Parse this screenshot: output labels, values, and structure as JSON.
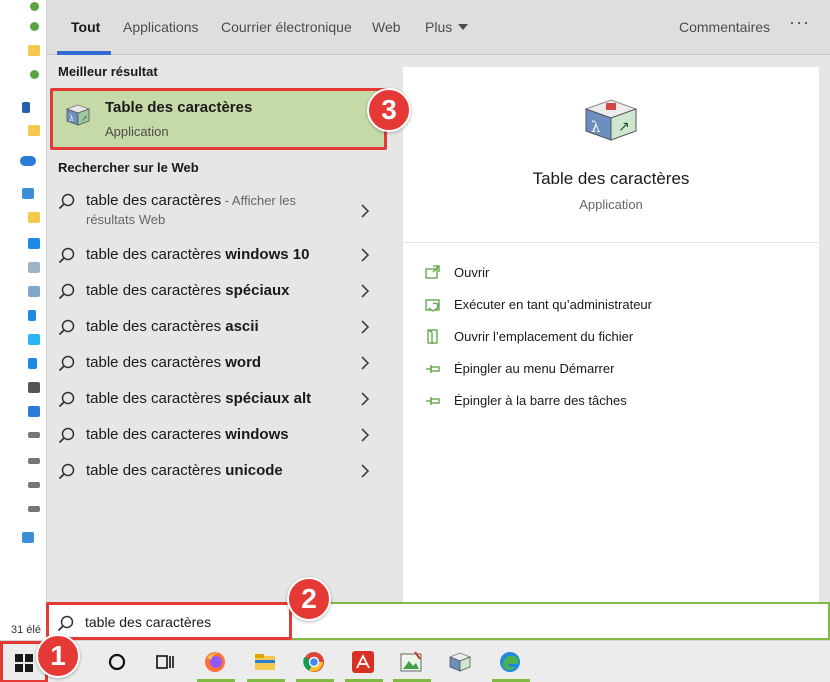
{
  "tabs": {
    "all": "Tout",
    "apps": "Applications",
    "mail": "Courrier électronique",
    "web": "Web",
    "more": "Plus",
    "feedback": "Commentaires",
    "more_options": "···"
  },
  "best_match": {
    "section_title": "Meilleur résultat",
    "name": "Table des caractères",
    "type": "Application"
  },
  "web_search": {
    "section_title": "Rechercher sur le Web",
    "first": {
      "query": "table des caractères",
      "suffix": " - Afficher les",
      "suffix2": "résultats Web"
    },
    "items": [
      {
        "prefix": "table des caractères ",
        "bold": "windows 10"
      },
      {
        "prefix": "table des caractères ",
        "bold": "spéciaux"
      },
      {
        "prefix": "table des caractères ",
        "bold": "ascii"
      },
      {
        "prefix": "table des caractères ",
        "bold": "word"
      },
      {
        "prefix": "table des caractères ",
        "bold": "spéciaux alt"
      },
      {
        "prefix": "table des caracteres ",
        "bold": "windows"
      },
      {
        "prefix": "table des caractères ",
        "bold": "unicode"
      }
    ]
  },
  "preview": {
    "name": "Table des caractères",
    "type": "Application",
    "actions": [
      {
        "label": "Ouvrir",
        "icon": "open-icon"
      },
      {
        "label": "Exécuter en tant qu’administrateur",
        "icon": "shield-icon"
      },
      {
        "label": "Ouvrir l’emplacement du fichier",
        "icon": "folder-location-icon"
      },
      {
        "label": "Épingler au menu Démarrer",
        "icon": "pin-icon"
      },
      {
        "label": "Épingler à la barre des tâches",
        "icon": "pin-icon"
      }
    ]
  },
  "search": {
    "value": "table des caractères"
  },
  "background": {
    "status_text": "31 élé"
  },
  "callouts": [
    "1",
    "2",
    "3"
  ],
  "colors": {
    "accent_green": "#7fba42",
    "highlight_red": "#e53935",
    "tab_blue": "#2f6bd1",
    "selected_bg": "#c6daa8"
  }
}
